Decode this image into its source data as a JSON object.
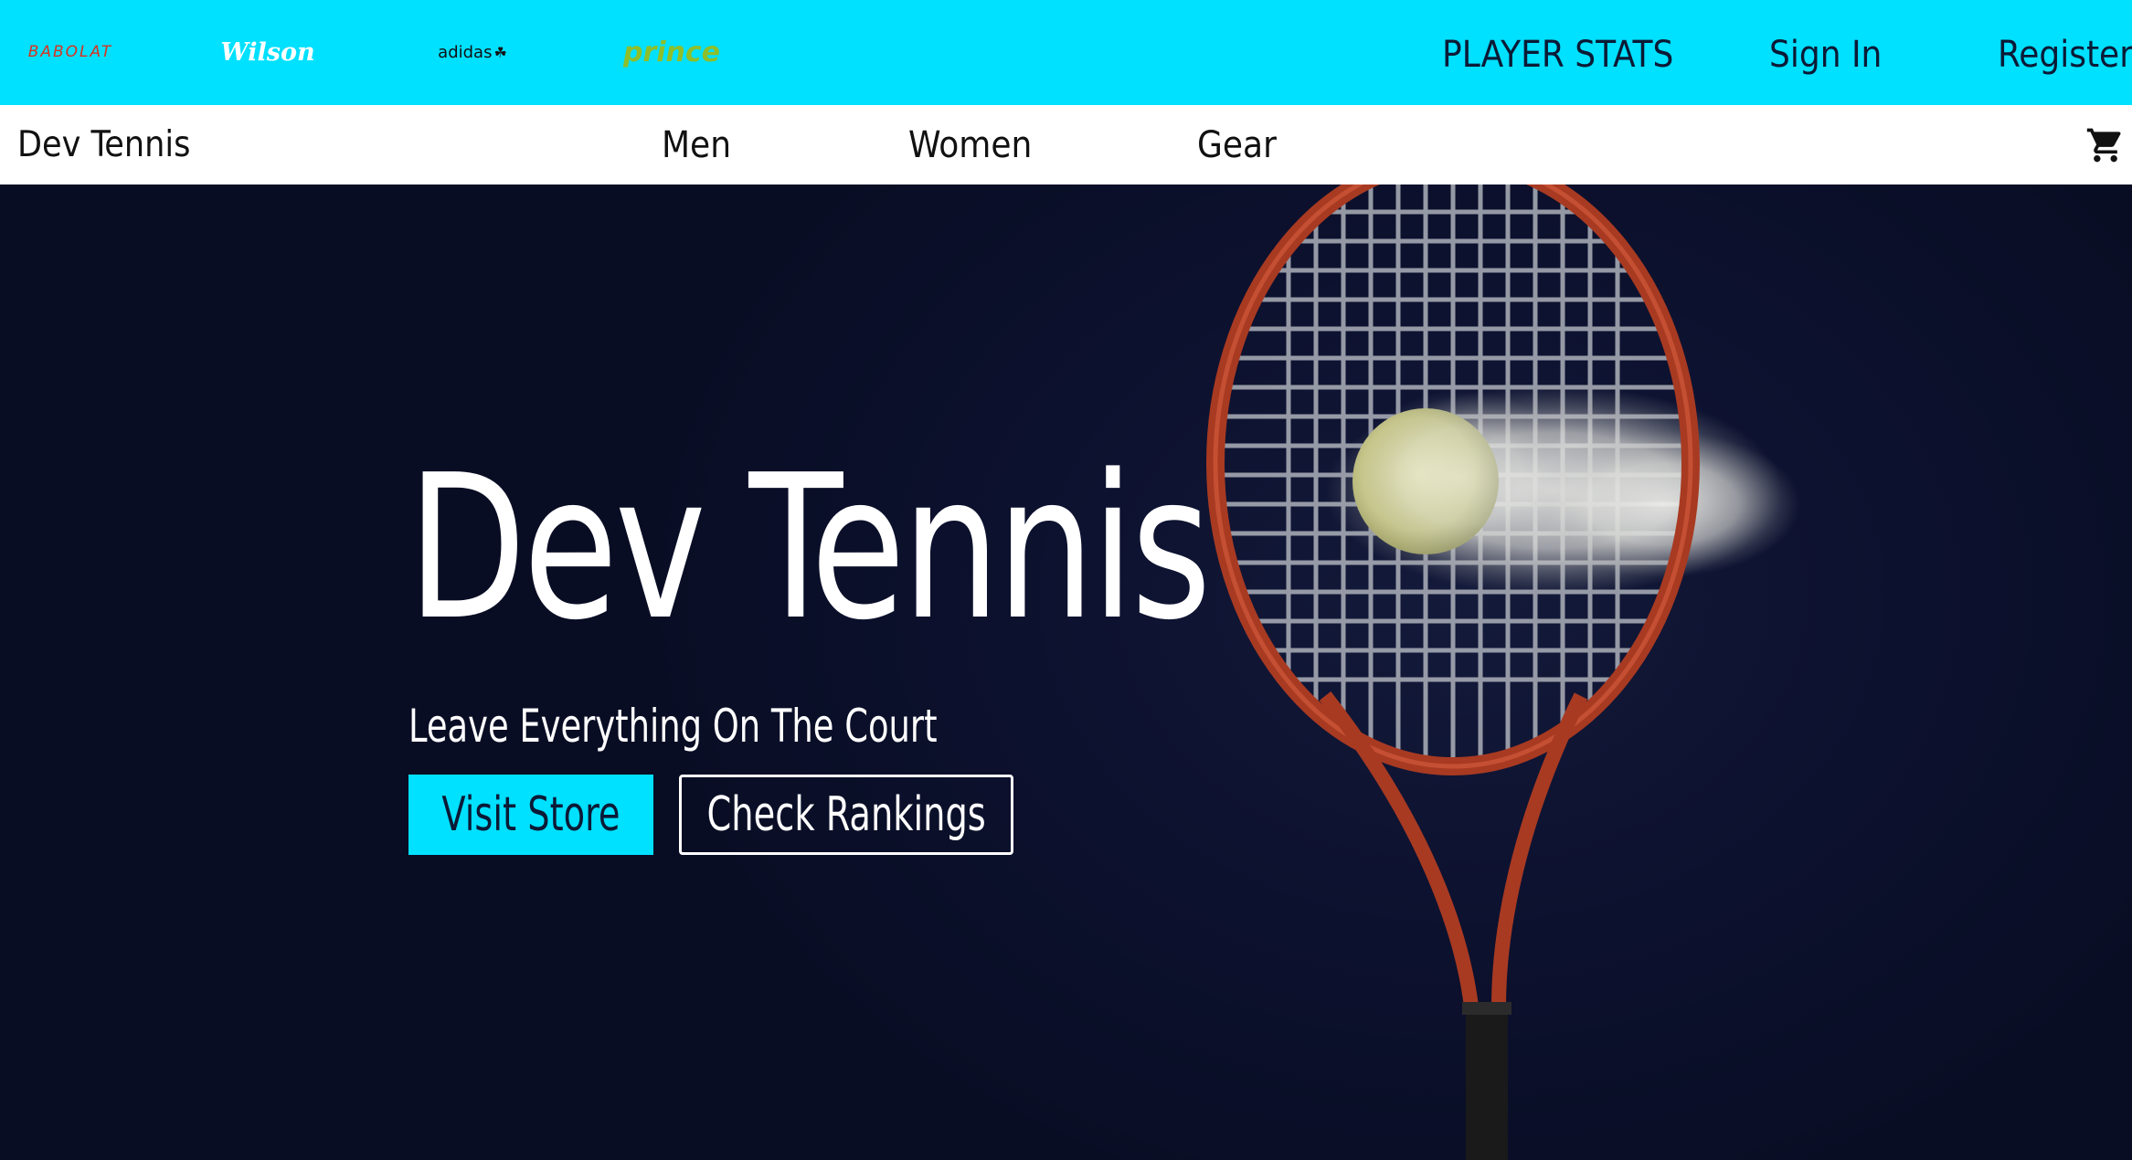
{
  "topbar": {
    "brands": {
      "babolat": "BABOLAT",
      "wilson": "Wilson",
      "adidas": "adidas",
      "prince": "prince"
    },
    "links": {
      "player_stats": "PLAYER STATS",
      "sign_in": "Sign In",
      "register": "Register"
    }
  },
  "nav": {
    "logo": "Dev Tennis",
    "links": {
      "men": "Men",
      "women": "Women",
      "gear": "Gear"
    },
    "cart_icon": "shopping-cart-icon"
  },
  "hero": {
    "title": "Dev Tennis",
    "subtitle": "Leave Everything On The Court",
    "buttons": {
      "visit_store": "Visit Store",
      "check_rankings": "Check Rankings"
    }
  },
  "colors": {
    "accent": "#00e0ff",
    "hero_background": "#0b0f22",
    "racket_frame": "#b8442a",
    "babolat_red": "#d8331f",
    "prince_green": "#8ebf2a"
  }
}
